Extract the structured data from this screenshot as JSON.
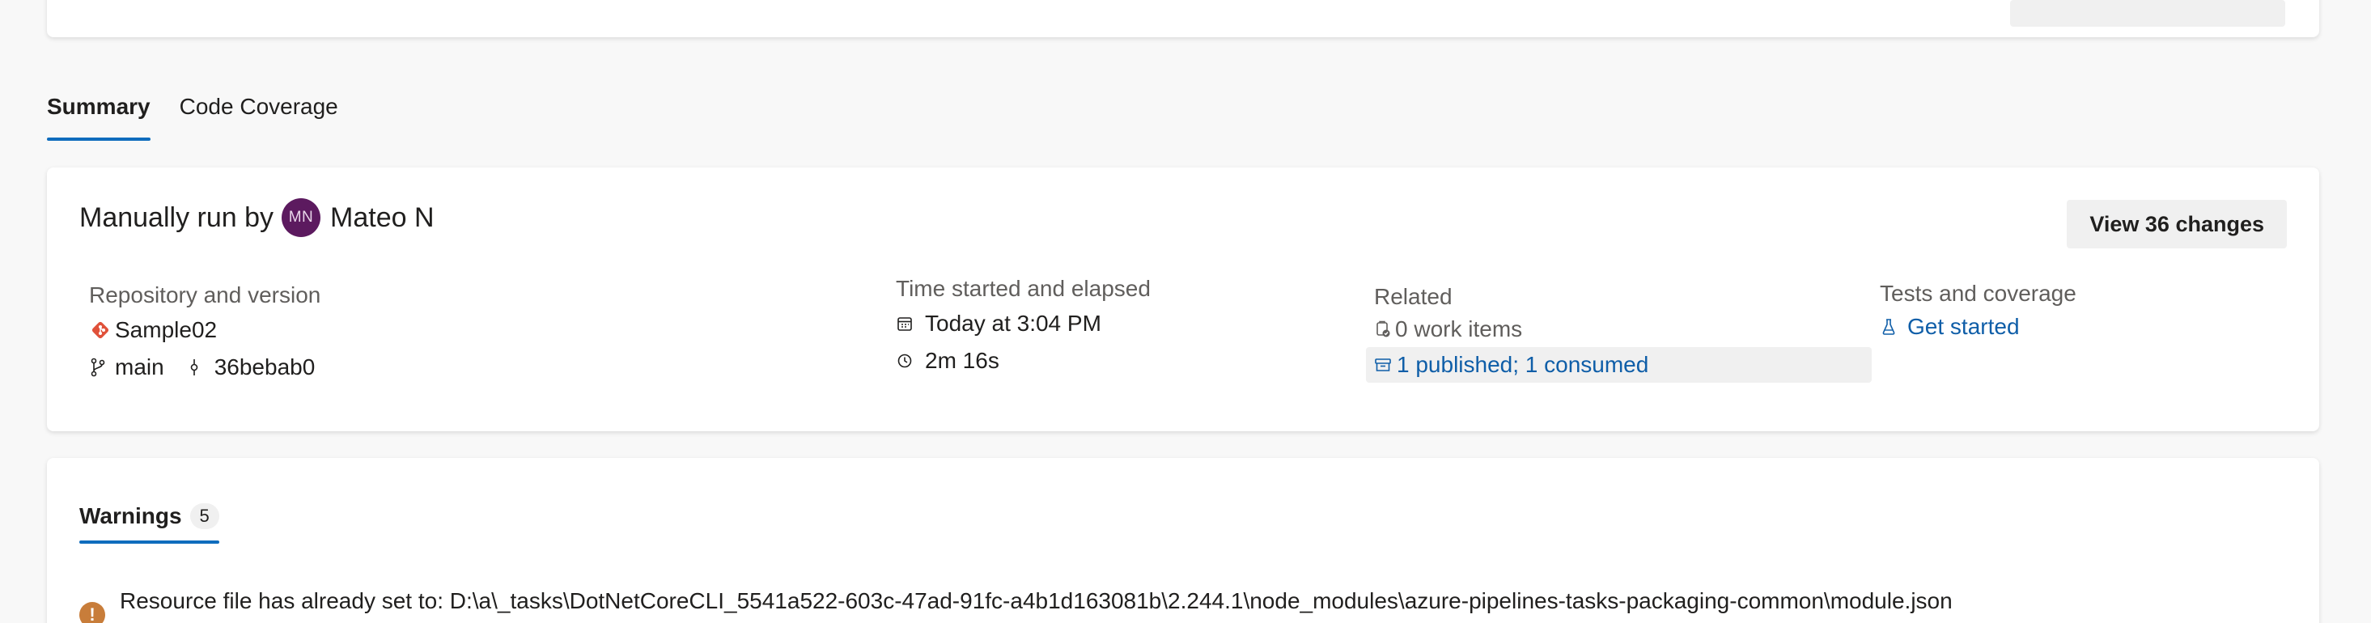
{
  "tabs": [
    {
      "label": "Summary",
      "active": true
    },
    {
      "label": "Code Coverage",
      "active": false
    }
  ],
  "summary": {
    "run_prefix": "Manually run by",
    "avatar_initials": "MN",
    "user_name": "Mateo N",
    "view_changes_label": "View 36 changes",
    "repo": {
      "label": "Repository and version",
      "name": "Sample02",
      "branch": "main",
      "commit": "36bebab0"
    },
    "time": {
      "label": "Time started and elapsed",
      "started": "Today at 3:04 PM",
      "elapsed": "2m 16s"
    },
    "related": {
      "label": "Related",
      "work_items": "0 work items",
      "artifacts": "1 published; 1 consumed"
    },
    "tests": {
      "label": "Tests and coverage",
      "link": "Get started"
    }
  },
  "warnings": {
    "tab_label": "Warnings",
    "count": "5",
    "items": [
      "Resource file has already set to: D:\\a\\_tasks\\DotNetCoreCLI_5541a522-603c-47ad-91fc-a4b1d163081b\\2.244.1\\node_modules\\azure-pipelines-tasks-packaging-common\\module.json"
    ]
  },
  "colors": {
    "accent": "#0f6cbd",
    "link": "#0f5ea8",
    "avatar_bg": "#5c1a5f",
    "warning": "#c87d3a",
    "git_icon": "#e0513a"
  },
  "icons": {
    "repo": "git-repo-icon",
    "branch": "branch-icon",
    "commit": "commit-icon",
    "calendar": "calendar-icon",
    "clock": "clock-icon",
    "work_item": "work-item-icon",
    "artifact": "artifact-icon",
    "beaker": "beaker-icon",
    "warning": "warning-icon"
  }
}
